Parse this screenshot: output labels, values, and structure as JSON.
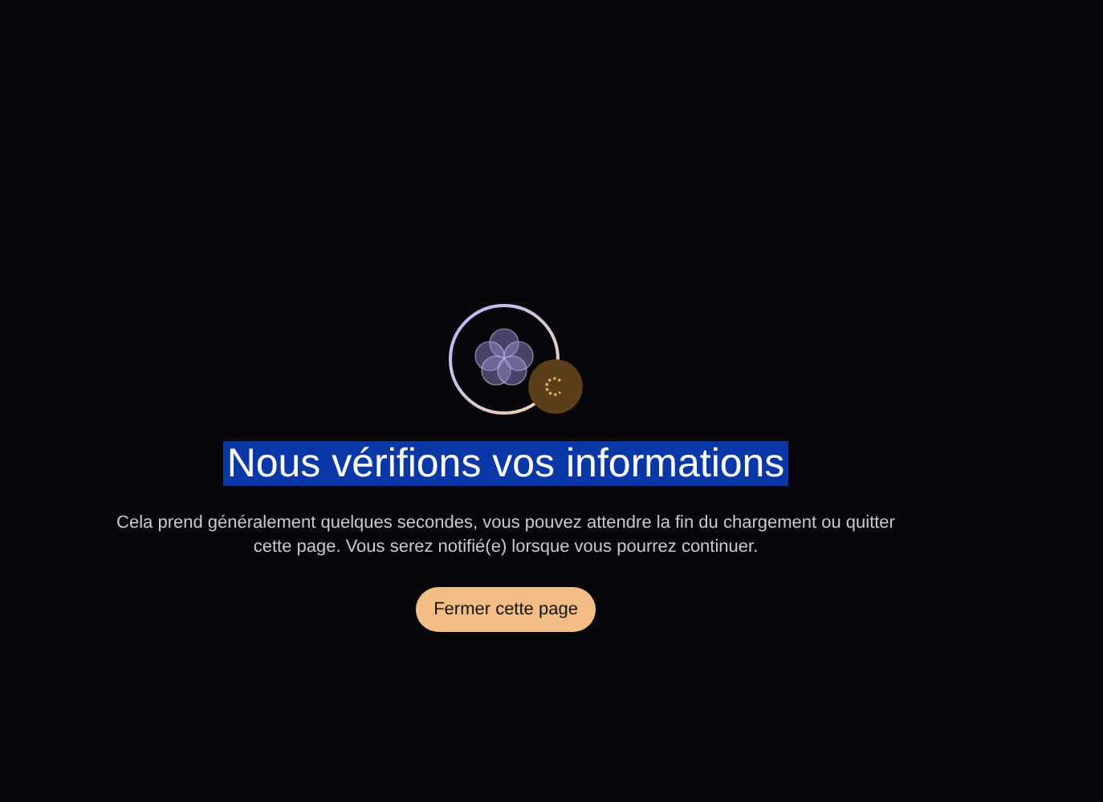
{
  "title": {
    "text": "Nous vérifions vos informations",
    "text_selected": true
  },
  "message": "Cela prend généralement quelques secondes, vous pouvez attendre la fin du chargement ou quitter cette page. Vous serez notifié(e) lorsque vous pourrez continuer.",
  "button": {
    "label": "Fermer cette page"
  }
}
